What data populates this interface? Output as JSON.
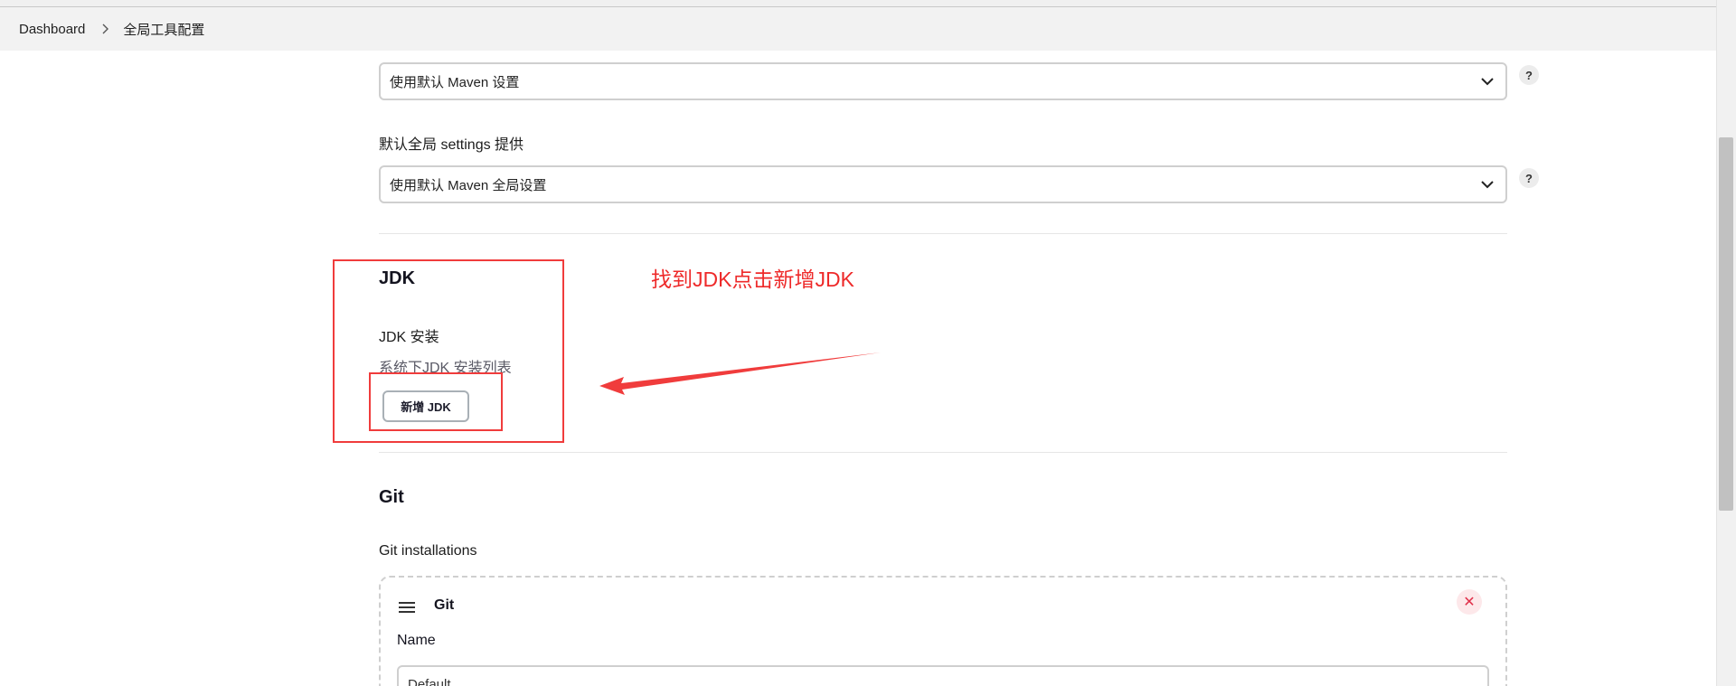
{
  "breadcrumb": {
    "items": [
      "Dashboard",
      "全局工具配置"
    ]
  },
  "maven": {
    "settings_select": "使用默认 Maven 设置",
    "global_settings_label": "默认全局 settings 提供",
    "global_settings_select": "使用默认 Maven 全局设置",
    "help": "?"
  },
  "jdk": {
    "title": "JDK",
    "installations_label": "JDK 安装",
    "installations_desc": "系统下JDK 安装列表",
    "add_button": "新增 JDK"
  },
  "annotation": {
    "text": "找到JDK点击新增JDK",
    "color": "#ee2a2a"
  },
  "git": {
    "title": "Git",
    "installations_label": "Git installations",
    "card_title": "Git",
    "name_label": "Name",
    "name_value": "Default",
    "delete_icon": "close-icon"
  },
  "colors": {
    "annotation_red": "#f03c3c",
    "breadcrumb_bg": "#f2f2f2"
  }
}
